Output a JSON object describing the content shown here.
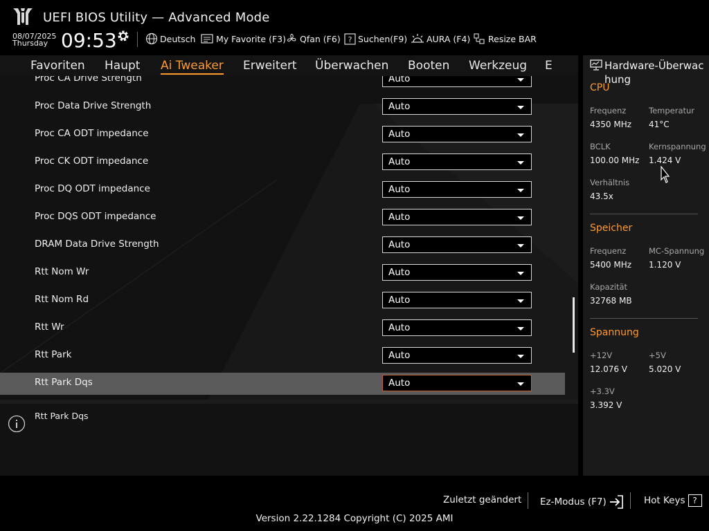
{
  "header": {
    "title": "UEFI BIOS Utility — Advanced Mode",
    "date": "08/07/2025",
    "weekday": "Thursday",
    "time": "09:53",
    "toolbar": [
      {
        "label": "Deutsch",
        "icon": "globe-icon"
      },
      {
        "label": "My Favorite (F3)",
        "icon": "favorite-icon"
      },
      {
        "label": "Qfan (F6)",
        "icon": "fan-icon"
      },
      {
        "label": "Suchen(F9)",
        "icon": "help-search-icon"
      },
      {
        "label": "AURA (F4)",
        "icon": "aura-icon"
      },
      {
        "label": "Resize BAR",
        "icon": "resize-bar-icon"
      }
    ]
  },
  "tabs": [
    {
      "label": "Favoriten"
    },
    {
      "label": "Haupt"
    },
    {
      "label": "Ai Tweaker",
      "active": true
    },
    {
      "label": "Erweitert"
    },
    {
      "label": "Überwachen"
    },
    {
      "label": "Booten"
    },
    {
      "label": "Werkzeug"
    },
    {
      "label": "E"
    }
  ],
  "settings": [
    {
      "label": "Proc CA Drive Strength",
      "value": "Auto"
    },
    {
      "label": "Proc Data Drive Strength",
      "value": "Auto"
    },
    {
      "label": "Proc CA ODT impedance",
      "value": "Auto"
    },
    {
      "label": "Proc CK ODT impedance",
      "value": "Auto"
    },
    {
      "label": "Proc DQ ODT impedance",
      "value": "Auto"
    },
    {
      "label": "Proc DQS ODT impedance",
      "value": "Auto"
    },
    {
      "label": "DRAM Data Drive Strength",
      "value": "Auto"
    },
    {
      "label": "Rtt Nom Wr",
      "value": "Auto"
    },
    {
      "label": "Rtt Nom Rd",
      "value": "Auto"
    },
    {
      "label": "Rtt Wr",
      "value": "Auto"
    },
    {
      "label": "Rtt Park",
      "value": "Auto"
    },
    {
      "label": "Rtt Park Dqs",
      "value": "Auto",
      "selected": true
    }
  ],
  "help": {
    "text": "Rtt Park Dqs"
  },
  "hardware": {
    "title": "Hardware-Überwachung",
    "cpu": {
      "section": "CPU",
      "freq_label": "Frequenz",
      "freq_value": "4350 MHz",
      "temp_label": "Temperatur",
      "temp_value": "41°C",
      "bclk_label": "BCLK",
      "bclk_value": "100.00 MHz",
      "vcore_label": "Kernspannung",
      "vcore_value": "1.424 V",
      "ratio_label": "Verhältnis",
      "ratio_value": "43.5x"
    },
    "memory": {
      "section": "Speicher",
      "freq_label": "Frequenz",
      "freq_value": "5400 MHz",
      "mc_label": "MC-Spannung",
      "mc_value": "1.120 V",
      "cap_label": "Kapazität",
      "cap_value": "32768 MB"
    },
    "voltage": {
      "section": "Spannung",
      "v12_label": "+12V",
      "v12_value": "12.076 V",
      "v5_label": "+5V",
      "v5_value": "5.020 V",
      "v33_label": "+3.3V",
      "v33_value": "3.392 V"
    }
  },
  "footer": {
    "last_modified": "Zuletzt geändert",
    "ez_mode": "Ez-Modus (F7)",
    "hot_keys": "Hot Keys",
    "hot_keys_badge": "?",
    "version": "Version 2.22.1284 Copyright (C) 2025 AMI"
  },
  "colors": {
    "accent": "#ff9a2e",
    "selected_row": "#5a5a5a",
    "panel": "#1a1a1a"
  }
}
